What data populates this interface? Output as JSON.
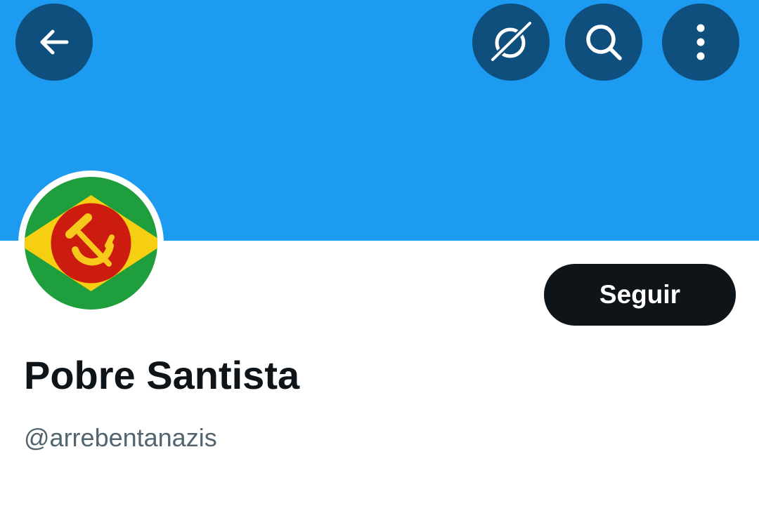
{
  "colors": {
    "banner": "#1d9bf0",
    "icon_button_bg": "#0f4f7d",
    "follow_bg": "#0f1419",
    "follow_text": "#ffffff",
    "name": "#0f1419",
    "handle": "#536471"
  },
  "header": {
    "back_icon": "arrow-left-icon",
    "grok_icon": "grok-slash-icon",
    "search_icon": "search-icon",
    "more_icon": "more-vertical-icon"
  },
  "profile": {
    "avatar_icon": "hammer-sickle-flag-avatar",
    "display_name": "Pobre Santista",
    "handle": "@arrebentanazis",
    "follow_label": "Seguir"
  }
}
